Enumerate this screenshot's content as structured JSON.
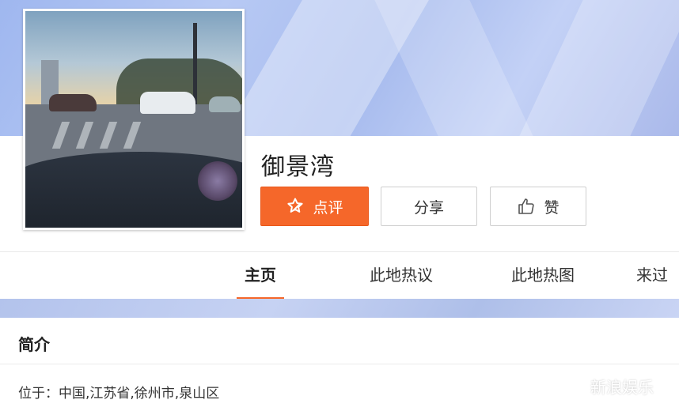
{
  "poi": {
    "name": "御景湾",
    "photo_icon": "poi-photo"
  },
  "actions": {
    "review": {
      "label": "点评",
      "icon": "star-pen-icon"
    },
    "share": {
      "label": "分享"
    },
    "like": {
      "label": "赞",
      "icon": "thumbs-up-icon"
    }
  },
  "tabs": [
    {
      "label": "主页",
      "active": true
    },
    {
      "label": "此地热议",
      "active": false
    },
    {
      "label": "此地热图",
      "active": false
    },
    {
      "label": "来过此",
      "active": false
    }
  ],
  "intro": {
    "title": "简介",
    "location": "位于：中国,江苏省,徐州市,泉山区"
  },
  "watermark": {
    "text": "新浪娱乐",
    "icon": "wechat-icon"
  },
  "colors": {
    "accent": "#f5672a",
    "banner": "#a8bcee"
  }
}
